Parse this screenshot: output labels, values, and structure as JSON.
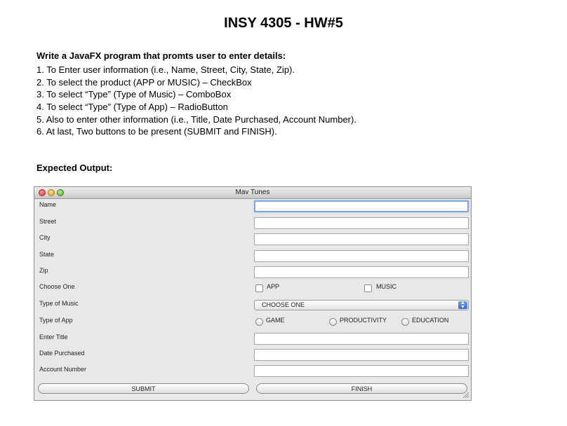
{
  "document": {
    "title": "INSY 4305 - HW#5",
    "heading": "Write a JavaFX program that promts user to enter details:",
    "instructions": [
      "1. To Enter user information (i.e., Name, Street, City, State, Zip).",
      "2. To select the product (APP or MUSIC) – CheckBox",
      "3. To select “Type” (Type of Music) – ComboBox",
      "4. To select “Type” (Type of App) – RadioButton",
      "5. Also to enter other information (i.e., Title, Date Purchased, Account Number).",
      "6. At last, Two buttons to be present (SUBMIT and FINISH)."
    ],
    "expected_label": "Expected Output:"
  },
  "window": {
    "title": "Mav Tunes",
    "fields": {
      "name": "Name",
      "street": "Street",
      "city": "City",
      "state": "State",
      "zip": "Zip",
      "choose_one": "Choose One",
      "type_of_music": "Type of Music",
      "type_of_app": "Type of App",
      "enter_title": "Enter Title",
      "date_purchased": "Date Purchased",
      "account_number": "Account Number"
    },
    "checkboxes": {
      "app": "APP",
      "music": "MUSIC"
    },
    "combo": {
      "selected": "CHOOSE ONE"
    },
    "radios": {
      "game": "GAME",
      "productivity": "PRODUCTIVITY",
      "education": "EDUCATION"
    },
    "buttons": {
      "submit": "SUBMIT",
      "finish": "FINISH"
    }
  },
  "colors": {
    "focus_ring": "#7fa8e0",
    "combo_arrow": "#2d6fd4"
  }
}
